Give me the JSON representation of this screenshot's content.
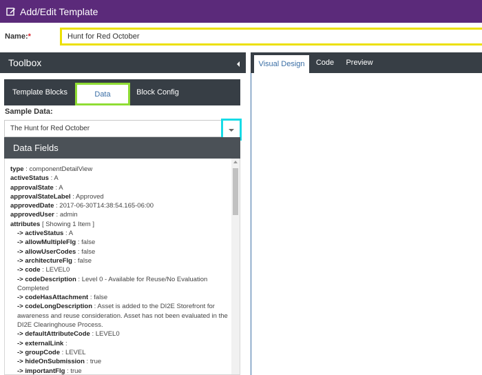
{
  "window": {
    "title": "Add/Edit Template"
  },
  "name_field": {
    "label": "Name:",
    "required_mark": "*",
    "value": "Hunt for Red October"
  },
  "toolbox": {
    "title": "Toolbox",
    "tabs": [
      {
        "label": "Template Blocks",
        "active": false
      },
      {
        "label": "Data",
        "active": true
      },
      {
        "label": "Block Config",
        "active": false
      }
    ],
    "sample_data_label": "Sample Data:",
    "sample_data_value": "The Hunt for Red October"
  },
  "data_fields": {
    "title": "Data Fields",
    "rows": [
      {
        "key": "type",
        "sep": " : ",
        "value": "componentDetailView",
        "indent": false
      },
      {
        "key": "activeStatus",
        "sep": " : ",
        "value": "A",
        "indent": false
      },
      {
        "key": "approvalState",
        "sep": " : ",
        "value": "A",
        "indent": false
      },
      {
        "key": "approvalStateLabel",
        "sep": " : ",
        "value": "Approved",
        "indent": false
      },
      {
        "key": "approvedDate",
        "sep": " : ",
        "value": "2017-06-30T14:38:54.165-06:00",
        "indent": false
      },
      {
        "key": "approvedUser",
        "sep": " : ",
        "value": "admin",
        "indent": false
      },
      {
        "key": "attributes",
        "sep": " ",
        "value": "[ Showing 1 Item ]",
        "indent": false
      },
      {
        "key": "-> activeStatus",
        "sep": " : ",
        "value": "A",
        "indent": true
      },
      {
        "key": "-> allowMultipleFlg",
        "sep": " : ",
        "value": "false",
        "indent": true
      },
      {
        "key": "-> allowUserCodes",
        "sep": " : ",
        "value": "false",
        "indent": true
      },
      {
        "key": "-> architectureFlg",
        "sep": " : ",
        "value": "false",
        "indent": true
      },
      {
        "key": "-> code",
        "sep": " : ",
        "value": "LEVEL0",
        "indent": true
      },
      {
        "key": "-> codeDescription",
        "sep": " : ",
        "value": "Level 0 - Available for Reuse/No Evaluation Completed",
        "indent": true
      },
      {
        "key": "-> codeHasAttachment",
        "sep": " : ",
        "value": "false",
        "indent": true
      },
      {
        "key": "-> codeLongDescription",
        "sep": " : ",
        "value": "Asset is added to the DI2E Storefront for awareness and reuse consideration. Asset has not been evaluated in the DI2E Clearinghouse Process.",
        "indent": true
      },
      {
        "key": "-> defaultAttributeCode",
        "sep": " : ",
        "value": "LEVEL0",
        "indent": true
      },
      {
        "key": "-> externalLink",
        "sep": " :",
        "value": "",
        "indent": true
      },
      {
        "key": "-> groupCode",
        "sep": " : ",
        "value": "LEVEL",
        "indent": true
      },
      {
        "key": "-> hideOnSubmission",
        "sep": " : ",
        "value": "true",
        "indent": true
      },
      {
        "key": "-> importantFlg",
        "sep": " : ",
        "value": "true",
        "indent": true
      }
    ]
  },
  "designer": {
    "tabs": [
      {
        "label": "Visual Design",
        "active": true
      },
      {
        "label": "Code",
        "active": false
      },
      {
        "label": "Preview",
        "active": false
      }
    ]
  },
  "icons": {
    "title": "edit-icon",
    "collapse": "caret-left-icon",
    "dropdown": "caret-down-icon"
  },
  "colors": {
    "titlebar": "#5b2a7a",
    "panel_header": "#373e45",
    "highlight_name": "#ece000",
    "highlight_data_tab": "#8fdc34",
    "highlight_dropdown": "#17dbe6",
    "active_tab_text": "#3a6ea5"
  }
}
